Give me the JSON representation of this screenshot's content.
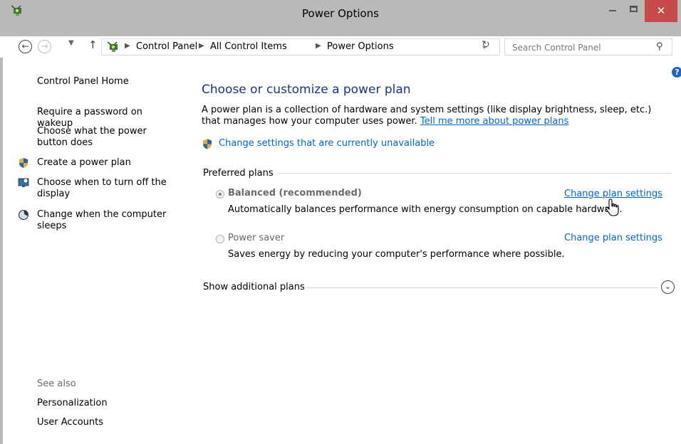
{
  "window": {
    "title": "Power Options"
  },
  "address": {
    "crumbs": [
      "Control Panel",
      "All Control Items",
      "Power Options"
    ],
    "search_placeholder": "Search Control Panel"
  },
  "sidebar": {
    "home": "Control Panel Home",
    "links": [
      {
        "label": "Require a password on wakeup"
      },
      {
        "label": "Choose what the power button does"
      },
      {
        "label": "Create a power plan",
        "icon": "shield-icon"
      },
      {
        "label": "Choose when to turn off the display",
        "icon": "monitor-icon"
      },
      {
        "label": "Change when the computer sleeps",
        "icon": "moon-icon"
      }
    ],
    "see_also_title": "See also",
    "see_also": [
      {
        "label": "Personalization"
      },
      {
        "label": "User Accounts"
      }
    ]
  },
  "main": {
    "title": "Choose or customize a power plan",
    "description": "A power plan is a collection of hardware and system settings (like display brightness, sleep, etc.) that manages how your computer uses power.",
    "description_link": "Tell me more about power plans",
    "uac_link": "Change settings that are currently unavailable",
    "preferred_label": "Preferred plans",
    "plans": [
      {
        "name": "Balanced (recommended)",
        "selected": true,
        "description": "Automatically balances performance with energy consumption on capable hardware.",
        "link": "Change plan settings"
      },
      {
        "name": "Power saver",
        "selected": false,
        "description": "Saves energy by reducing your computer's performance where possible.",
        "link": "Change plan settings"
      }
    ],
    "show_additional": "Show additional plans"
  },
  "colors": {
    "title_bar": "#b9b9b9",
    "close_button": "#c74b4b",
    "link": "#0066cc",
    "heading": "#1e3287"
  }
}
